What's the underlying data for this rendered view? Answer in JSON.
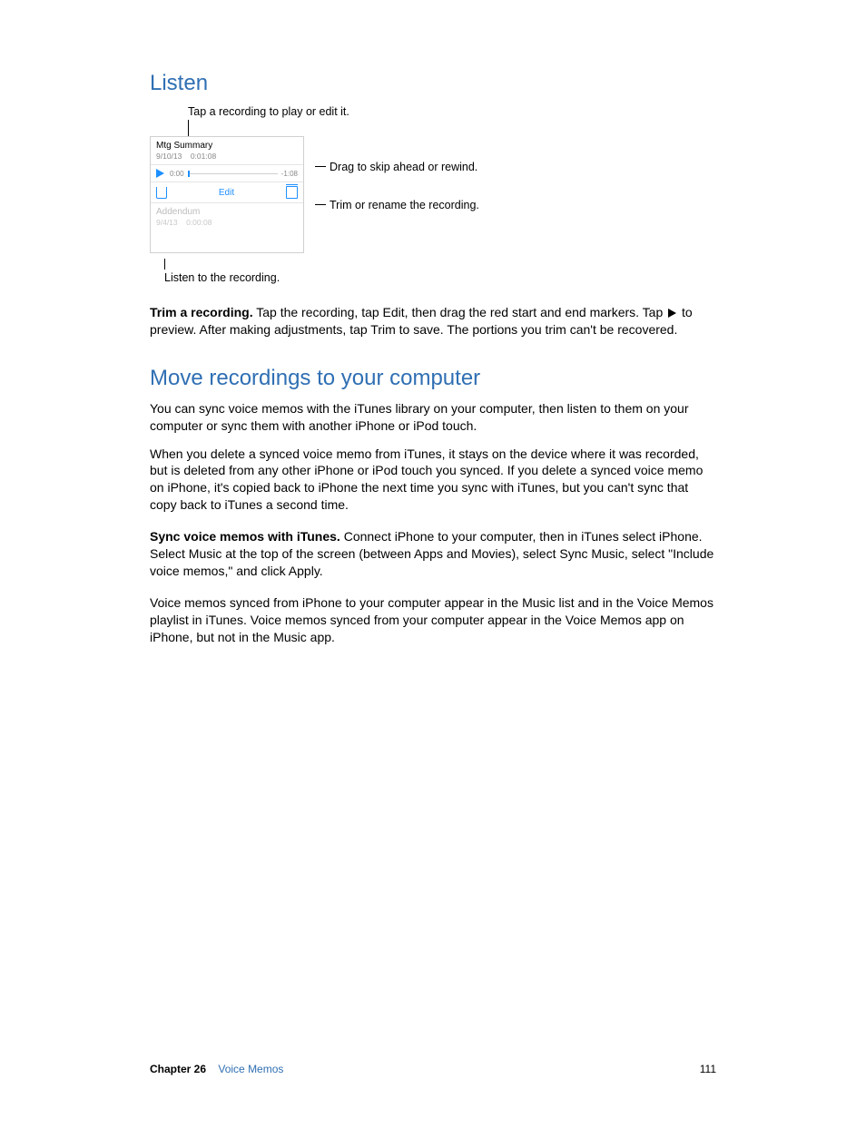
{
  "listen": {
    "heading": "Listen",
    "callout_top": "Tap a recording to play or edit it.",
    "callout_drag": "Drag to skip ahead or rewind.",
    "callout_trim": "Trim or rename the recording.",
    "callout_listen": "Listen to the recording.",
    "phone": {
      "rec1_title": "Mtg Summary",
      "rec1_date": "9/10/13",
      "rec1_dur": "0:01:08",
      "play_cur": "0:00",
      "play_rem": "-1:08",
      "edit_label": "Edit",
      "rec2_title": "Addendum",
      "rec2_date": "9/4/13",
      "rec2_dur": "0:00:08"
    },
    "trim_bold": "Trim a recording.",
    "trim_text_a": " Tap the recording, tap Edit, then drag the red start and end markers. Tap ",
    "trim_text_b": " to preview. After making adjustments, tap Trim to save. The portions you trim can't be recovered."
  },
  "move": {
    "heading": "Move recordings to your computer",
    "p1": "You can sync voice memos with the iTunes library on your computer, then listen to them on your computer or sync them with another iPhone or iPod touch.",
    "p2": "When you delete a synced voice memo from iTunes, it stays on the device where it was recorded, but is deleted from any other iPhone or iPod touch you synced. If you delete a synced voice memo on iPhone, it's copied back to iPhone the next time you sync with iTunes, but you can't sync that copy back to iTunes a second time.",
    "sync_bold": "Sync voice memos with iTunes.",
    "sync_text": " Connect iPhone to your computer, then in iTunes select iPhone. Select Music at the top of the screen (between Apps and Movies), select Sync Music, select \"Include voice memos,\" and click Apply.",
    "p4": "Voice memos synced from iPhone to your computer appear in the Music list and in the Voice Memos playlist in iTunes. Voice memos synced from your computer appear in the Voice Memos app on iPhone, but not in the Music app."
  },
  "footer": {
    "chapter_label": "Chapter  26",
    "chapter_title": "Voice Memos",
    "page_num": "111"
  }
}
